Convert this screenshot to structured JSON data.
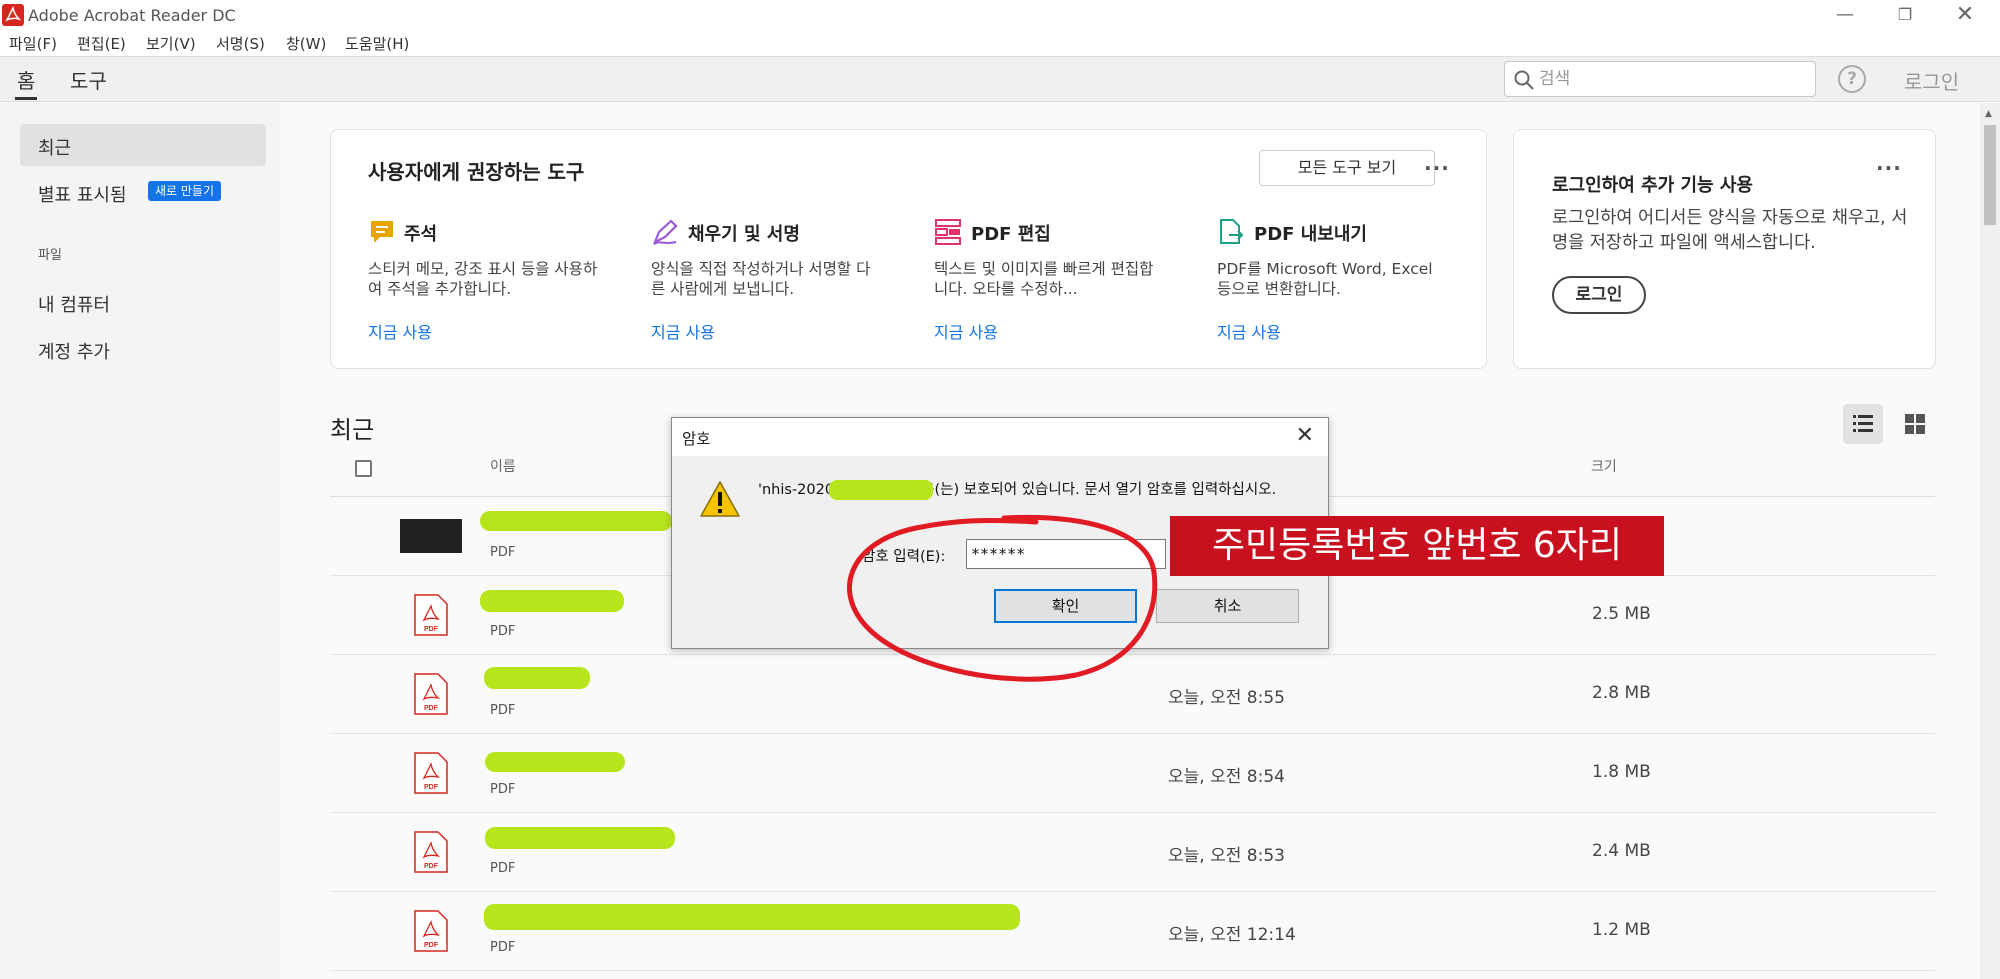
{
  "window": {
    "title": "Adobe Acrobat Reader DC",
    "controls": [
      "minimize-icon",
      "restore-icon",
      "close-icon"
    ]
  },
  "menu": {
    "items": [
      "파일(F)",
      "편집(E)",
      "보기(V)",
      "서명(S)",
      "창(W)",
      "도움말(H)"
    ]
  },
  "tabs": {
    "home": "홈",
    "tools": "도구",
    "search_placeholder": "검색",
    "help_glyph": "?",
    "login": "로그인"
  },
  "sidebar": {
    "recent": "최근",
    "starred": "별표 표시됨",
    "new_badge": "새로 만들기",
    "files_section": "파일",
    "my_computer": "내 컴퓨터",
    "add_account": "계정 추가"
  },
  "tools_card": {
    "title": "사용자에게 권장하는 도구",
    "all_tools_button": "모든 도구 보기",
    "more": "···",
    "tools": [
      {
        "name": "주석",
        "desc": "스티커 메모, 강조 표시 등을 사용하여 주석을 추가합니다.",
        "link": "지금 사용",
        "icon": "comment-icon",
        "color": "#e8a500"
      },
      {
        "name": "채우기 및 서명",
        "desc": "양식을 직접 작성하거나 서명할 다른 사람에게 보냅니다.",
        "link": "지금 사용",
        "icon": "fill-sign-icon",
        "color": "#9b59d6"
      },
      {
        "name": "PDF 편집",
        "desc": "텍스트 및 이미지를 빠르게 편집합니다. 오타를 수정하...",
        "link": "지금 사용",
        "icon": "edit-pdf-icon",
        "color": "#e0356b"
      },
      {
        "name": "PDF 내보내기",
        "desc": "PDF를 Microsoft Word, Excel 등으로 변환합니다.",
        "link": "지금 사용",
        "icon": "export-pdf-icon",
        "color": "#1aa187"
      }
    ]
  },
  "login_card": {
    "title": "로그인하여 추가 기능 사용",
    "desc": "로그인하여 어디서든 양식을 자동으로 채우고, 서명을 저장하고 파일에 액세스합니다.",
    "button": "로그인",
    "more": "···"
  },
  "recent": {
    "title": "최근",
    "col_name": "이름",
    "col_size": "크기",
    "rows": [
      {
        "type": "PDF",
        "opened": "",
        "size": ""
      },
      {
        "type": "PDF",
        "opened": "",
        "size": "2.5 MB"
      },
      {
        "type": "PDF",
        "opened": "오늘, 오전 8:55",
        "size": "2.8 MB"
      },
      {
        "type": "PDF",
        "opened": "오늘, 오전 8:54",
        "size": "1.8 MB"
      },
      {
        "type": "PDF",
        "opened": "오늘, 오전 8:53",
        "size": "2.4 MB"
      },
      {
        "type": "PDF",
        "opened": "오늘, 오전 12:14",
        "size": "1.2 MB"
      }
    ]
  },
  "dialog": {
    "title": "암호",
    "message": "'nhis-2020··········MH...'은(는) 보호되어 있습니다. 문서 열기 암호를 입력하십시오.",
    "password_label": "암호 입력(E):",
    "password_value": "******",
    "ok": "확인",
    "cancel": "취소"
  },
  "annotation": {
    "label": "주민등록번호 앞번호 6자리",
    "color": "#c8101e"
  },
  "colors": {
    "accent": "#1473e6",
    "highlight_redaction": "#b7e51c",
    "acrobat_red": "#d7261e"
  }
}
